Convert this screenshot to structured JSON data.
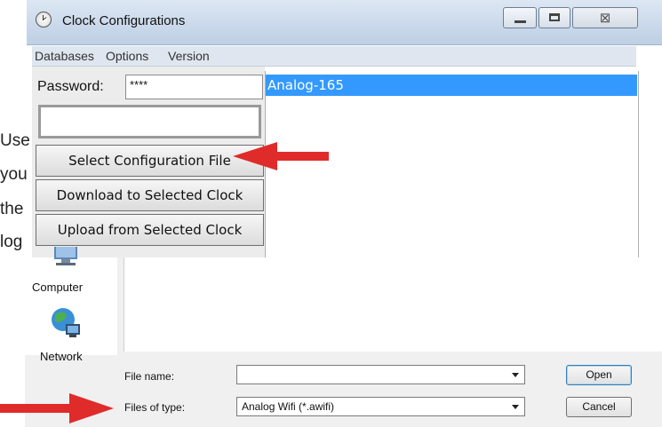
{
  "background_text": [
    "Use",
    "you",
    "the",
    "log"
  ],
  "window": {
    "title": "Clock Configurations",
    "close_symbol": "⊠",
    "menu": [
      "Databases",
      "Options",
      "Version"
    ],
    "password_label": "Password:",
    "password_value": "****",
    "buttons": {
      "select": "Select Configuration File",
      "download": "Download to Selected Clock",
      "upload": "Upload from Selected Clock"
    },
    "list_items": [
      "Analog-165"
    ]
  },
  "dialog": {
    "nav": [
      "Computer",
      "Network"
    ],
    "file_name_label": "File name:",
    "file_name_value": "",
    "files_of_type_label": "Files of type:",
    "files_of_type_value": "Analog Wifi (*.awifi)",
    "open_label": "Open",
    "cancel_label": "Cancel"
  },
  "colors": {
    "arrow": "#e02b2b",
    "selection": "#3399ff"
  }
}
